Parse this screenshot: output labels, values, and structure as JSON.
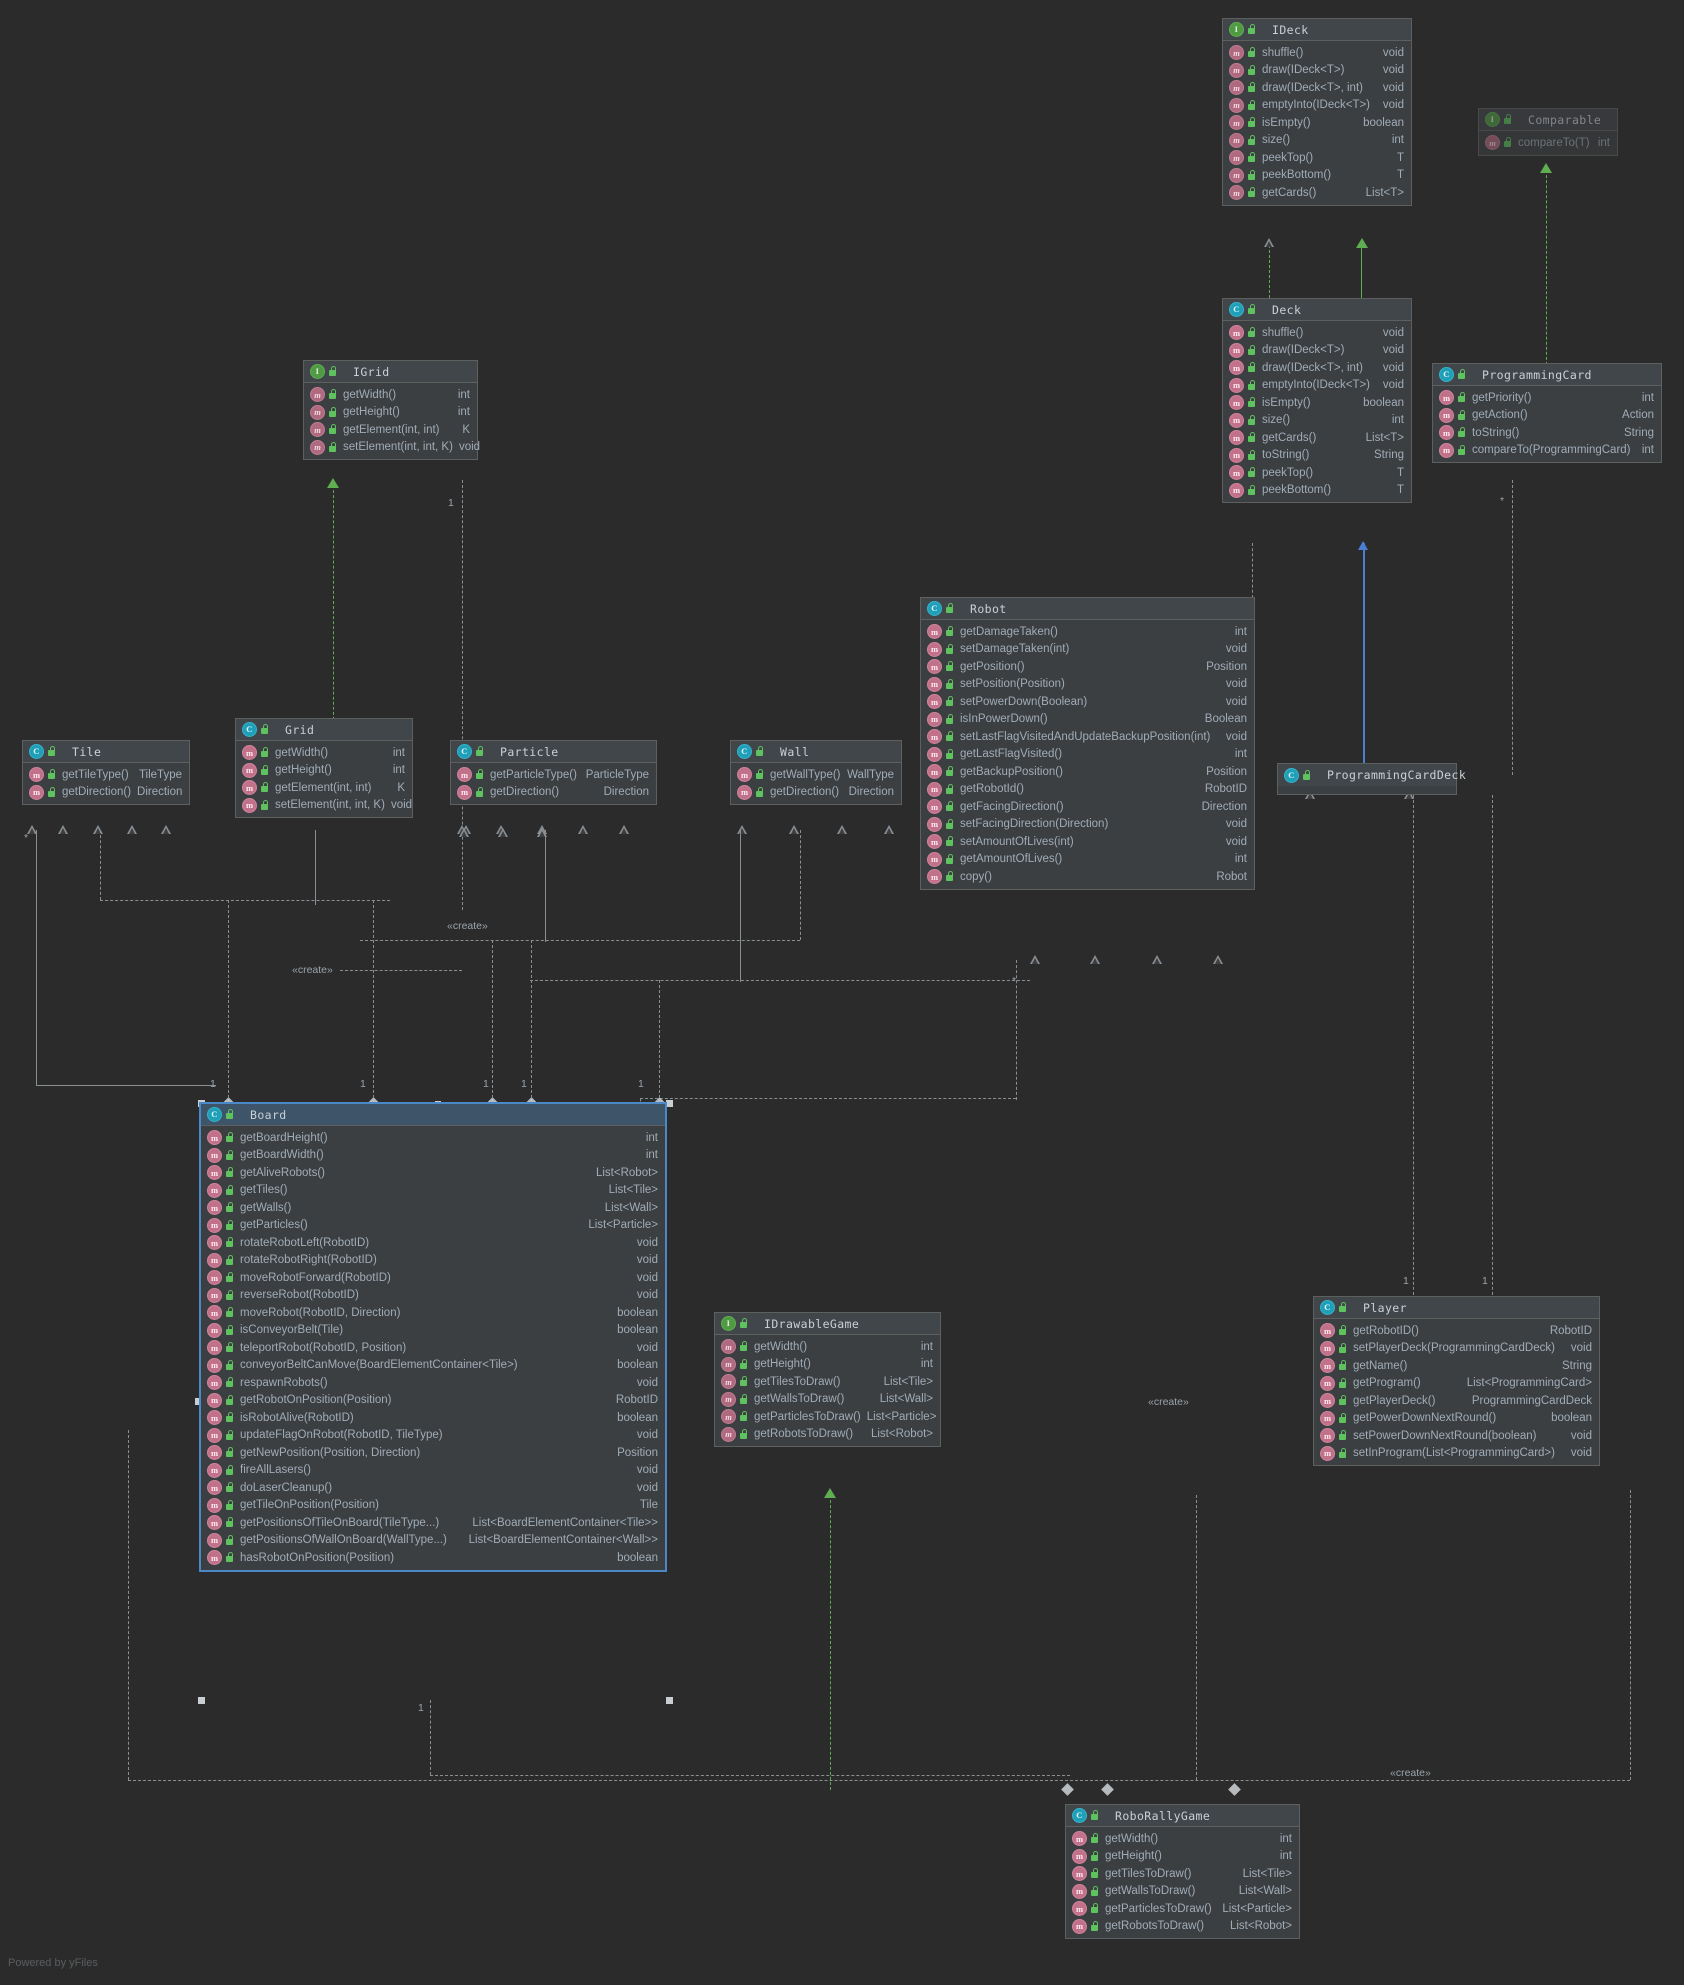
{
  "diagram": {
    "watermark": "Powered by yFiles",
    "background_color": "#2b2b2b",
    "box_color": "#3c3f41",
    "header_color": "#41464a",
    "border_color": "#5e6060",
    "selection_color": "#4a88c7",
    "text_color": "#a0acb8",
    "inherit_color": "#5fae52",
    "assoc_color": "#8a8f93",
    "blue_link_color": "#4a7fd4"
  },
  "classes": {
    "ideck": {
      "name": "IDeck",
      "kind": "interface",
      "members": [
        {
          "name": "shuffle()",
          "type": "void"
        },
        {
          "name": "draw(IDeck<T>)",
          "type": "void"
        },
        {
          "name": "draw(IDeck<T>, int)",
          "type": "void"
        },
        {
          "name": "emptyInto(IDeck<T>)",
          "type": "void"
        },
        {
          "name": "isEmpty()",
          "type": "boolean"
        },
        {
          "name": "size()",
          "type": "int"
        },
        {
          "name": "peekTop()",
          "type": "T"
        },
        {
          "name": "peekBottom()",
          "type": "T"
        },
        {
          "name": "getCards()",
          "type": "List<T>"
        }
      ]
    },
    "comparable": {
      "name": "Comparable",
      "kind": "interface",
      "members": [
        {
          "name": "compareTo(T)",
          "type": "int"
        }
      ]
    },
    "deck": {
      "name": "Deck",
      "kind": "class",
      "members": [
        {
          "name": "shuffle()",
          "type": "void"
        },
        {
          "name": "draw(IDeck<T>)",
          "type": "void"
        },
        {
          "name": "draw(IDeck<T>, int)",
          "type": "void"
        },
        {
          "name": "emptyInto(IDeck<T>)",
          "type": "void"
        },
        {
          "name": "isEmpty()",
          "type": "boolean"
        },
        {
          "name": "size()",
          "type": "int"
        },
        {
          "name": "getCards()",
          "type": "List<T>"
        },
        {
          "name": "toString()",
          "type": "String"
        },
        {
          "name": "peekTop()",
          "type": "T"
        },
        {
          "name": "peekBottom()",
          "type": "T"
        }
      ]
    },
    "programmingcard": {
      "name": "ProgrammingCard",
      "kind": "class",
      "members": [
        {
          "name": "getPriority()",
          "type": "int"
        },
        {
          "name": "getAction()",
          "type": "Action"
        },
        {
          "name": "toString()",
          "type": "String"
        },
        {
          "name": "compareTo(ProgrammingCard)",
          "type": "int"
        }
      ]
    },
    "programmingcarddeck": {
      "name": "ProgrammingCardDeck",
      "kind": "class",
      "members": []
    },
    "igrid": {
      "name": "IGrid",
      "kind": "interface",
      "members": [
        {
          "name": "getWidth()",
          "type": "int"
        },
        {
          "name": "getHeight()",
          "type": "int"
        },
        {
          "name": "getElement(int, int)",
          "type": "K"
        },
        {
          "name": "setElement(int, int, K)",
          "type": "void"
        }
      ]
    },
    "grid": {
      "name": "Grid",
      "kind": "class",
      "members": [
        {
          "name": "getWidth()",
          "type": "int"
        },
        {
          "name": "getHeight()",
          "type": "int"
        },
        {
          "name": "getElement(int, int)",
          "type": "K"
        },
        {
          "name": "setElement(int, int, K)",
          "type": "void"
        }
      ]
    },
    "tile": {
      "name": "Tile",
      "kind": "class",
      "members": [
        {
          "name": "getTileType()",
          "type": "TileType"
        },
        {
          "name": "getDirection()",
          "type": "Direction"
        }
      ]
    },
    "particle": {
      "name": "Particle",
      "kind": "class",
      "members": [
        {
          "name": "getParticleType()",
          "type": "ParticleType"
        },
        {
          "name": "getDirection()",
          "type": "Direction"
        }
      ]
    },
    "wall": {
      "name": "Wall",
      "kind": "class",
      "members": [
        {
          "name": "getWallType()",
          "type": "WallType"
        },
        {
          "name": "getDirection()",
          "type": "Direction"
        }
      ]
    },
    "robot": {
      "name": "Robot",
      "kind": "class",
      "members": [
        {
          "name": "getDamageTaken()",
          "type": "int"
        },
        {
          "name": "setDamageTaken(int)",
          "type": "void"
        },
        {
          "name": "getPosition()",
          "type": "Position"
        },
        {
          "name": "setPosition(Position)",
          "type": "void"
        },
        {
          "name": "setPowerDown(Boolean)",
          "type": "void"
        },
        {
          "name": "isInPowerDown()",
          "type": "Boolean"
        },
        {
          "name": "setLastFlagVisitedAndUpdateBackupPosition(int)",
          "type": "void"
        },
        {
          "name": "getLastFlagVisited()",
          "type": "int"
        },
        {
          "name": "getBackupPosition()",
          "type": "Position"
        },
        {
          "name": "getRobotId()",
          "type": "RobotID"
        },
        {
          "name": "getFacingDirection()",
          "type": "Direction"
        },
        {
          "name": "setFacingDirection(Direction)",
          "type": "void"
        },
        {
          "name": "setAmountOfLives(int)",
          "type": "void"
        },
        {
          "name": "getAmountOfLives()",
          "type": "int"
        },
        {
          "name": "copy()",
          "type": "Robot"
        }
      ]
    },
    "board": {
      "name": "Board",
      "kind": "class",
      "selected": true,
      "members": [
        {
          "name": "getBoardHeight()",
          "type": "int"
        },
        {
          "name": "getBoardWidth()",
          "type": "int"
        },
        {
          "name": "getAliveRobots()",
          "type": "List<Robot>"
        },
        {
          "name": "getTiles()",
          "type": "List<Tile>"
        },
        {
          "name": "getWalls()",
          "type": "List<Wall>"
        },
        {
          "name": "getParticles()",
          "type": "List<Particle>"
        },
        {
          "name": "rotateRobotLeft(RobotID)",
          "type": "void"
        },
        {
          "name": "rotateRobotRight(RobotID)",
          "type": "void"
        },
        {
          "name": "moveRobotForward(RobotID)",
          "type": "void"
        },
        {
          "name": "reverseRobot(RobotID)",
          "type": "void"
        },
        {
          "name": "moveRobot(RobotID, Direction)",
          "type": "boolean"
        },
        {
          "name": "isConveyorBelt(Tile)",
          "type": "boolean"
        },
        {
          "name": "teleportRobot(RobotID, Position)",
          "type": "void"
        },
        {
          "name": "conveyorBeltCanMove(BoardElementContainer<Tile>)",
          "type": "boolean"
        },
        {
          "name": "respawnRobots()",
          "type": "void"
        },
        {
          "name": "getRobotOnPosition(Position)",
          "type": "RobotID"
        },
        {
          "name": "isRobotAlive(RobotID)",
          "type": "boolean"
        },
        {
          "name": "updateFlagOnRobot(RobotID, TileType)",
          "type": "void"
        },
        {
          "name": "getNewPosition(Position, Direction)",
          "type": "Position"
        },
        {
          "name": "fireAllLasers()",
          "type": "void"
        },
        {
          "name": "doLaserCleanup()",
          "type": "void"
        },
        {
          "name": "getTileOnPosition(Position)",
          "type": "Tile"
        },
        {
          "name": "getPositionsOfTileOnBoard(TileType...)",
          "type": "List<BoardElementContainer<Tile>>"
        },
        {
          "name": "getPositionsOfWallOnBoard(WallType...)",
          "type": "List<BoardElementContainer<Wall>>"
        },
        {
          "name": "hasRobotOnPosition(Position)",
          "type": "boolean"
        }
      ]
    },
    "idrawablegame": {
      "name": "IDrawableGame",
      "kind": "interface",
      "members": [
        {
          "name": "getWidth()",
          "type": "int"
        },
        {
          "name": "getHeight()",
          "type": "int"
        },
        {
          "name": "getTilesToDraw()",
          "type": "List<Tile>"
        },
        {
          "name": "getWallsToDraw()",
          "type": "List<Wall>"
        },
        {
          "name": "getParticlesToDraw()",
          "type": "List<Particle>"
        },
        {
          "name": "getRobotsToDraw()",
          "type": "List<Robot>"
        }
      ]
    },
    "player": {
      "name": "Player",
      "kind": "class",
      "members": [
        {
          "name": "getRobotID()",
          "type": "RobotID"
        },
        {
          "name": "setPlayerDeck(ProgrammingCardDeck)",
          "type": "void"
        },
        {
          "name": "getName()",
          "type": "String"
        },
        {
          "name": "getProgram()",
          "type": "List<ProgrammingCard>"
        },
        {
          "name": "getPlayerDeck()",
          "type": "ProgrammingCardDeck"
        },
        {
          "name": "getPowerDownNextRound()",
          "type": "boolean"
        },
        {
          "name": "setPowerDownNextRound(boolean)",
          "type": "void"
        },
        {
          "name": "setInProgram(List<ProgrammingCard>)",
          "type": "void"
        }
      ]
    },
    "roborallygame": {
      "name": "RoboRallyGame",
      "kind": "class",
      "members": [
        {
          "name": "getWidth()",
          "type": "int"
        },
        {
          "name": "getHeight()",
          "type": "int"
        },
        {
          "name": "getTilesToDraw()",
          "type": "List<Tile>"
        },
        {
          "name": "getWallsToDraw()",
          "type": "List<Wall>"
        },
        {
          "name": "getParticlesToDraw()",
          "type": "List<Particle>"
        },
        {
          "name": "getRobotsToDraw()",
          "type": "List<Robot>"
        }
      ]
    }
  },
  "labels": {
    "create": "«create»",
    "one": "1",
    "star": "*"
  }
}
